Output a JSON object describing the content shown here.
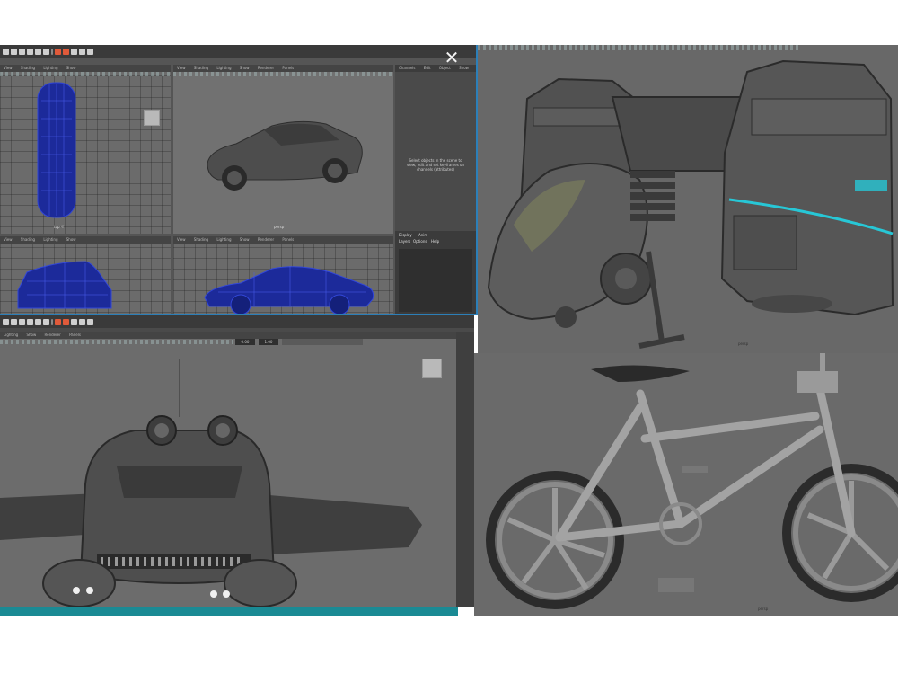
{
  "top_left_window": {
    "panel_menu": [
      "View",
      "Shading",
      "Lighting",
      "Show",
      "Renderer",
      "Panels"
    ],
    "viewports": [
      {
        "name": "top",
        "label": "top -Y"
      },
      {
        "name": "persp",
        "label": "persp"
      },
      {
        "name": "front",
        "label": ""
      },
      {
        "name": "side",
        "label": ""
      }
    ],
    "side_panel": {
      "menu": [
        "Channels",
        "Edit",
        "Object",
        "Show"
      ],
      "hint": "Select objects in the scene to view, edit and set keyframes on channels (attributes)",
      "display_label": "Display",
      "display_value": "Anim",
      "display_menu": [
        "Layers",
        "Options",
        "Help"
      ]
    }
  },
  "bottom_left_window": {
    "panel_menu": [
      "Lighting",
      "Show",
      "Renderer",
      "Panels"
    ],
    "field_values": [
      "0.00",
      "1.00"
    ]
  },
  "drone_view": {
    "label": "persp"
  },
  "bike_view": {
    "label": "persp"
  },
  "colors": {
    "viewport_gray": "#6b6b6b",
    "wireframe_blue": "#1c2a9a",
    "accent_cyan": "#27c7d6",
    "maya_blue_bar": "#2c7fb8",
    "teal_bar": "#1a8a94"
  }
}
